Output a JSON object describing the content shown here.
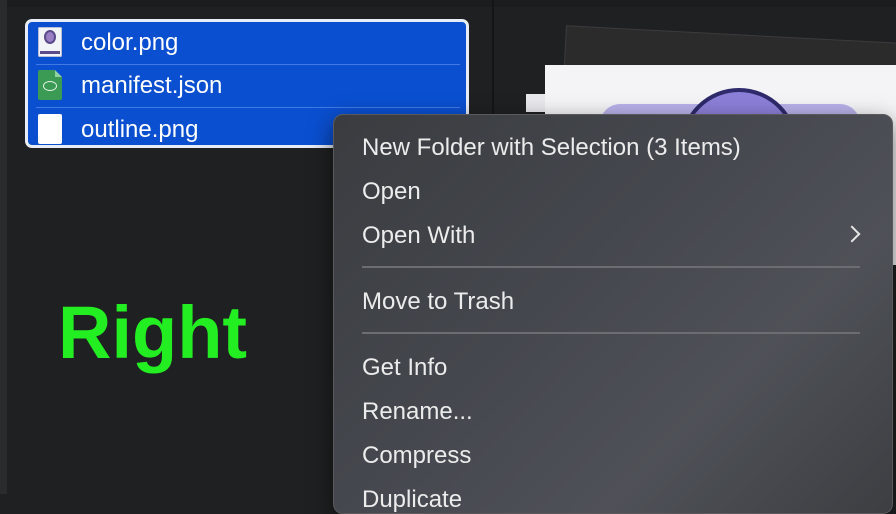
{
  "files": [
    {
      "name": "color.png",
      "icon": "png-thumbnail-icon"
    },
    {
      "name": "manifest.json",
      "icon": "json-file-icon"
    },
    {
      "name": "outline.png",
      "icon": "blank-png-icon"
    }
  ],
  "overlay_label": "Right",
  "overlay_label_color": "#22ee22",
  "selection_color": "#0a4fd0",
  "context_menu": {
    "new_folder": "New Folder with Selection (3 Items)",
    "open": "Open",
    "open_with": "Open With",
    "move_to_trash": "Move to Trash",
    "get_info": "Get Info",
    "rename": "Rename...",
    "compress": "Compress",
    "duplicate": "Duplicate"
  }
}
